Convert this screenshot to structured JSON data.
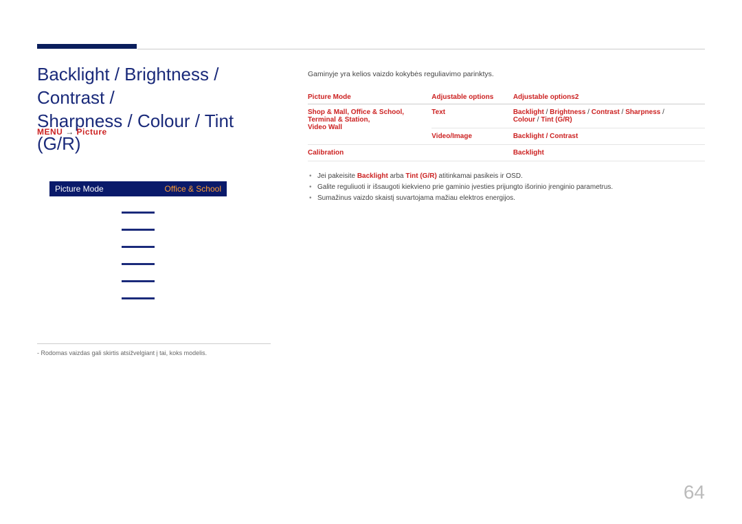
{
  "title_line1": "Backlight / Brightness / Contrast /",
  "title_line2": "Sharpness / Colour / Tint (G/R)",
  "subtitle_menu": "MENU",
  "subtitle_arrow": "→",
  "subtitle_path": "Picture",
  "footnote_left": "Rodomas vaizdas gali skirtis atsižvelgiant į tai, koks modelis.",
  "menu": {
    "left": "Picture Mode",
    "right": "Office & School"
  },
  "intro": "Gaminyje yra kelios vaizdo kokybės reguliavimo parinktys.",
  "table": {
    "headers": [
      "Picture Mode",
      "Adjustable options",
      "Adjustable options2"
    ],
    "rows": [
      {
        "c1_a": "Shop & Mall",
        "c1_b": "Office & School",
        "c1_c": "Terminal & Station",
        "c1_d": "Video Wall",
        "c2": "Text",
        "c3_parts": [
          "Backlight",
          "Brightness",
          "Contrast",
          "Sharpness",
          "Colour",
          "Tint (G/R)"
        ]
      },
      {
        "c1": "",
        "c2": "Video/Image",
        "c3": "Backlight / Contrast"
      },
      {
        "c1": "Calibration",
        "c2": "",
        "c3": "Backlight"
      }
    ]
  },
  "notes": [
    {
      "pre": "Jei pakeisite ",
      "hl1": "Backlight",
      "mid1": " arba ",
      "hl2": "Tint (G/R)",
      "mid2": " atitinkamai pasikeis ir OSD."
    },
    {
      "text": "Galite reguliuoti ir išsaugoti kiekvieno prie gaminio įvesties prijungto išorinio įrenginio parametrus."
    },
    {
      "text": "Sumažinus vaizdo skaistį suvartojama mažiau elektros energijos."
    }
  ],
  "page_number": "64"
}
